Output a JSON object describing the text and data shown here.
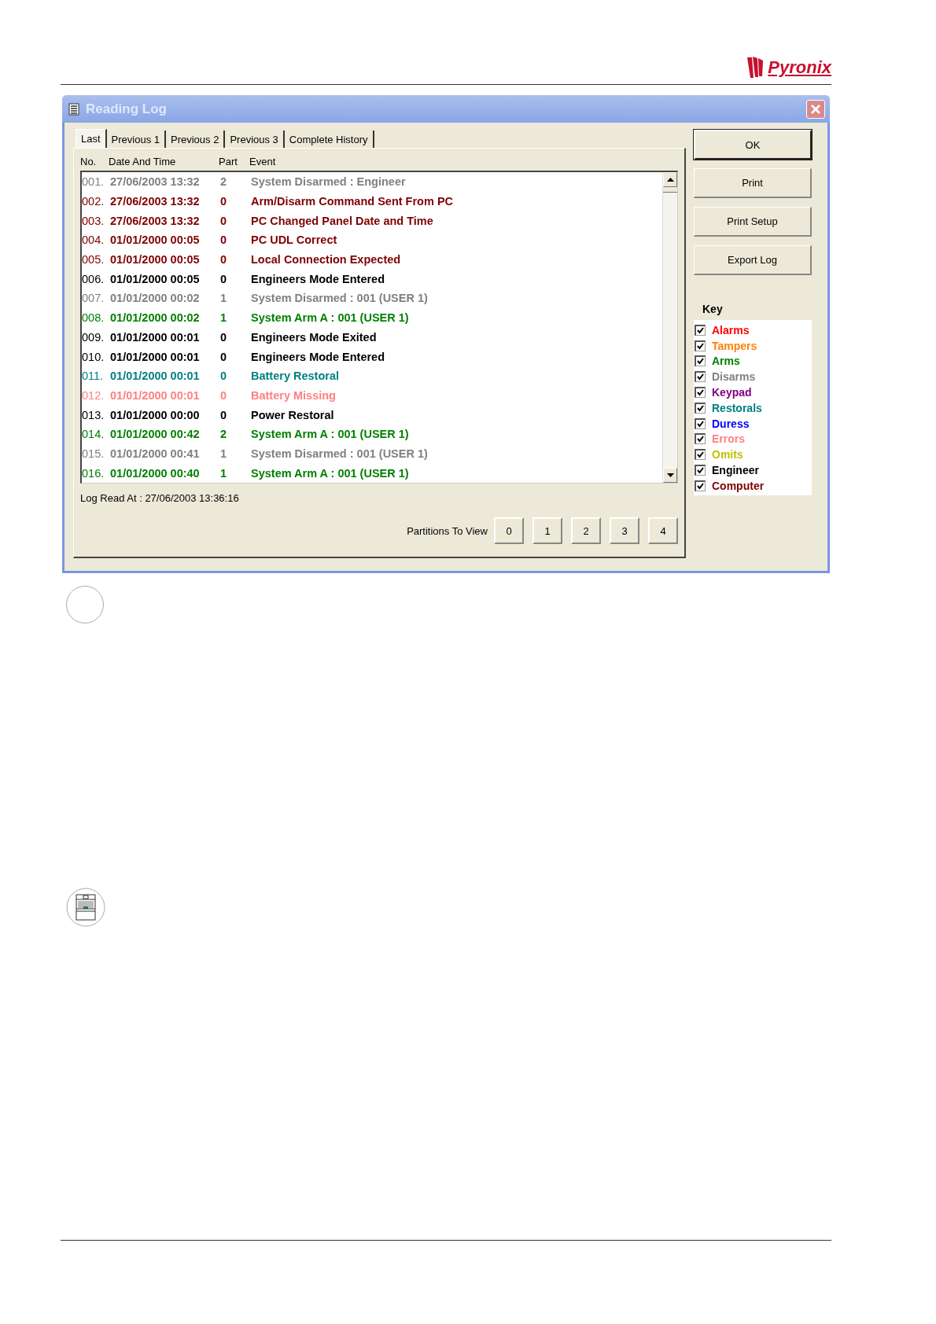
{
  "header": {
    "logo": "Pyronix"
  },
  "window": {
    "title": "Reading Log"
  },
  "tabs": [
    {
      "label": "Last",
      "selected": true
    },
    {
      "label": "Previous 1",
      "selected": false
    },
    {
      "label": "Previous 2",
      "selected": false
    },
    {
      "label": "Previous 3",
      "selected": false
    },
    {
      "label": "Complete History",
      "selected": false
    }
  ],
  "table": {
    "columns": [
      "No.",
      "Date And Time",
      "Part",
      "Event"
    ],
    "rows": [
      {
        "no": "001.",
        "datetime": "27/06/2003 13:32",
        "part": "2",
        "event": "System Disarmed : Engineer",
        "color": "#808080"
      },
      {
        "no": "002.",
        "datetime": "27/06/2003 13:32",
        "part": "0",
        "event": "Arm/Disarm Command Sent From PC",
        "color": "#800000"
      },
      {
        "no": "003.",
        "datetime": "27/06/2003 13:32",
        "part": "0",
        "event": "PC Changed Panel Date and Time",
        "color": "#800000"
      },
      {
        "no": "004.",
        "datetime": "01/01/2000 00:05",
        "part": "0",
        "event": "PC UDL Correct",
        "color": "#800000"
      },
      {
        "no": "005.",
        "datetime": "01/01/2000 00:05",
        "part": "0",
        "event": "Local Connection Expected",
        "color": "#800000"
      },
      {
        "no": "006.",
        "datetime": "01/01/2000 00:05",
        "part": "0",
        "event": "Engineers Mode Entered",
        "color": "#000000"
      },
      {
        "no": "007.",
        "datetime": "01/01/2000 00:02",
        "part": "1",
        "event": "System Disarmed : 001 (USER 1)",
        "color": "#808080"
      },
      {
        "no": "008.",
        "datetime": "01/01/2000 00:02",
        "part": "1",
        "event": "System Arm A : 001 (USER 1)",
        "color": "#008000"
      },
      {
        "no": "009.",
        "datetime": "01/01/2000 00:01",
        "part": "0",
        "event": "Engineers Mode Exited",
        "color": "#000000"
      },
      {
        "no": "010.",
        "datetime": "01/01/2000 00:01",
        "part": "0",
        "event": "Engineers Mode Entered",
        "color": "#000000"
      },
      {
        "no": "011.",
        "datetime": "01/01/2000 00:01",
        "part": "0",
        "event": "Battery Restoral",
        "color": "#008080"
      },
      {
        "no": "012.",
        "datetime": "01/01/2000 00:01",
        "part": "0",
        "event": "Battery Missing",
        "color": "#ff8080"
      },
      {
        "no": "013.",
        "datetime": "01/01/2000 00:00",
        "part": "0",
        "event": "Power Restoral",
        "color": "#000000"
      },
      {
        "no": "014.",
        "datetime": "01/01/2000 00:42",
        "part": "2",
        "event": "System Arm A : 001 (USER 1)",
        "color": "#008000"
      },
      {
        "no": "015.",
        "datetime": "01/01/2000 00:41",
        "part": "1",
        "event": "System Disarmed : 001 (USER 1)",
        "color": "#808080"
      },
      {
        "no": "016.",
        "datetime": "01/01/2000 00:40",
        "part": "1",
        "event": "System Arm A : 001 (USER 1)",
        "color": "#008000"
      }
    ]
  },
  "log_read_at": "Log Read At : 27/06/2003 13:36:16",
  "partitions": {
    "label": "Partitions To View",
    "buttons": [
      "0",
      "1",
      "2",
      "3",
      "4"
    ]
  },
  "buttons": [
    "OK",
    "Print",
    "Print Setup",
    "Export Log"
  ],
  "key": {
    "title": "Key",
    "items": [
      {
        "label": "Alarms",
        "checked": true,
        "color": "#ff0000"
      },
      {
        "label": "Tampers",
        "checked": true,
        "color": "#ff8000"
      },
      {
        "label": "Arms",
        "checked": true,
        "color": "#008000"
      },
      {
        "label": "Disarms",
        "checked": true,
        "color": "#808080"
      },
      {
        "label": "Keypad",
        "checked": true,
        "color": "#800080"
      },
      {
        "label": "Restorals",
        "checked": true,
        "color": "#008080"
      },
      {
        "label": "Duress",
        "checked": true,
        "color": "#0000ff"
      },
      {
        "label": "Errors",
        "checked": true,
        "color": "#ff8080"
      },
      {
        "label": "Omits",
        "checked": true,
        "color": "#c0c000"
      },
      {
        "label": "Engineer",
        "checked": true,
        "color": "#000000"
      },
      {
        "label": "Computer",
        "checked": true,
        "color": "#800000"
      }
    ]
  }
}
